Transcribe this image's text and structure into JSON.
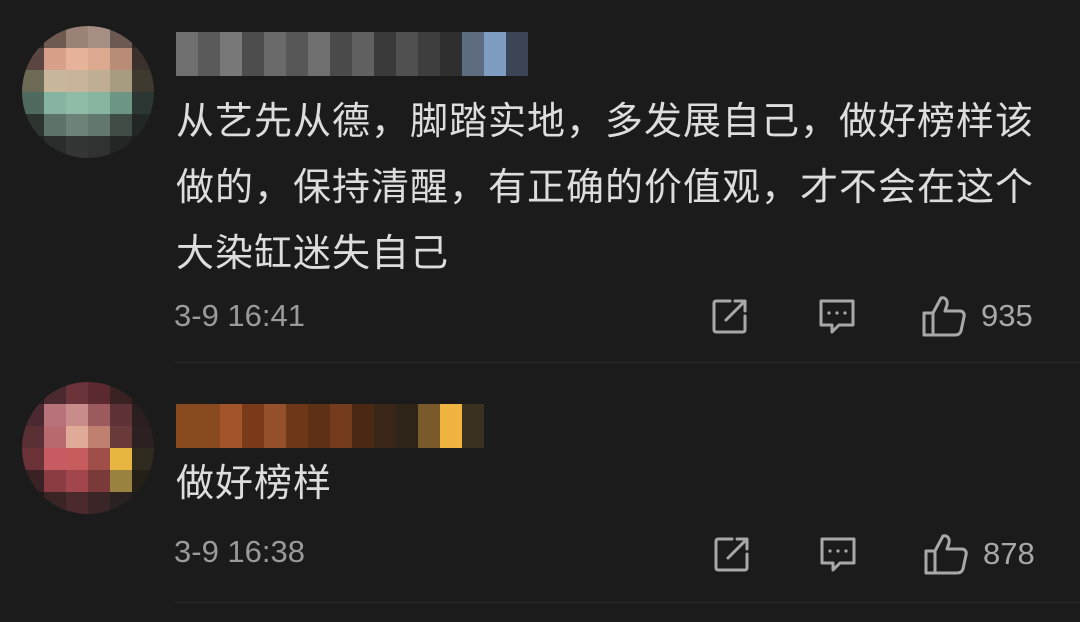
{
  "comments": [
    {
      "text": "从艺先从德，脚踏实地，多发展自己，做好榜样该做的，保持清醒，有正确的价值观，才不会在这个大染缸迷失自己",
      "time": "3-9 16:41",
      "likes": "935",
      "icons": [
        "share-icon",
        "reply-icon",
        "like-icon"
      ]
    },
    {
      "text": "做好榜样",
      "time": "3-9 16:38",
      "likes": "878",
      "icons": [
        "share-icon",
        "reply-icon",
        "like-icon"
      ]
    }
  ],
  "colors": {
    "background": "#1b1b1b",
    "text": "#dddddd",
    "meta": "#9a9a9a"
  }
}
